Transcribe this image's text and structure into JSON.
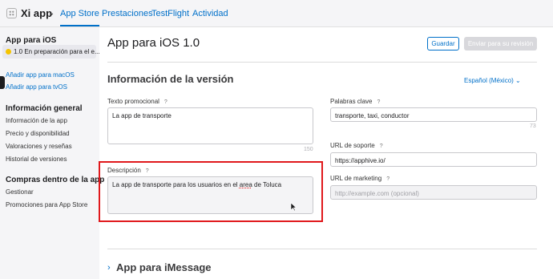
{
  "header": {
    "app_name": "Xi app",
    "tabs": [
      {
        "label": "App Store",
        "active": true
      },
      {
        "label": "Prestaciones"
      },
      {
        "label": "TestFlight"
      },
      {
        "label": "Actividad"
      }
    ]
  },
  "sidebar": {
    "ios_heading": "App para iOS",
    "selected_version": "1.0 En preparación para el e...",
    "links": [
      "Añadir app para macOS",
      "Añadir app para tvOS"
    ],
    "general_heading": "Información general",
    "general_items": [
      "Información de la app",
      "Precio y disponibilidad",
      "Valoraciones y reseñas",
      "Historial de versiones"
    ],
    "iap_heading": "Compras dentro de la app",
    "iap_items": [
      "Gestionar",
      "Promociones para App Store"
    ]
  },
  "main": {
    "title": "App para iOS 1.0",
    "save_label": "Guardar",
    "submit_label": "Enviar para su revisión",
    "version_info_title": "Información de la versión",
    "language": "Español (México) ⌄",
    "promo_label": "Texto promocional",
    "promo_value": "La app de transporte",
    "promo_counter": "150",
    "desc_label": "Descripción",
    "desc_value_pre": "La app de transporte para los usuarios en el ",
    "desc_value_spell": "area",
    "desc_value_post": " de Toluca",
    "keywords_label": "Palabras clave",
    "keywords_value": "transporte, taxi, conductor",
    "keywords_counter": "73",
    "support_label": "URL de soporte",
    "support_value": "https://apphive.io/",
    "marketing_label": "URL de marketing",
    "marketing_placeholder": "http://example.com (opcional)",
    "help_glyph": "?",
    "imessage_title": "App para iMessage",
    "imessage_chevron": "›"
  }
}
